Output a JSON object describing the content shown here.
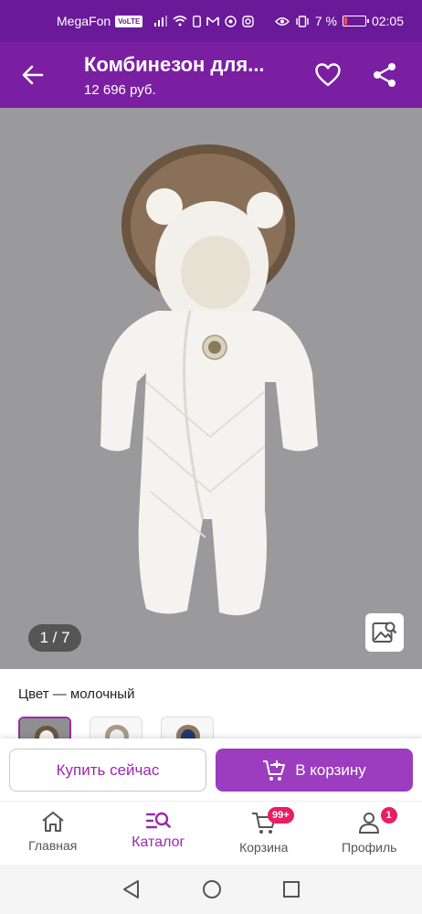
{
  "status_bar": {
    "carrier": "MegaFon",
    "volte": "VoLTE",
    "battery_percent": "7 %",
    "time": "02:05"
  },
  "app_bar": {
    "title": "Комбинезон для...",
    "price": "12 696 руб."
  },
  "gallery": {
    "counter": "1 / 7"
  },
  "color": {
    "label": "Цвет — молочный"
  },
  "actions": {
    "buy_now": "Купить сейчас",
    "add_to_cart": "В корзину"
  },
  "bottom_nav": {
    "items": [
      {
        "label": "Главная",
        "icon": "home-icon"
      },
      {
        "label": "Каталог",
        "icon": "catalog-search-icon"
      },
      {
        "label": "Корзина",
        "icon": "cart-icon",
        "badge": "99+"
      },
      {
        "label": "Профиль",
        "icon": "profile-icon",
        "badge": "1"
      }
    ],
    "active_index": 1
  },
  "colors": {
    "statusbar": "#6a1a99",
    "appbar": "#7b1fa2",
    "accent": "#9c27b0",
    "badge": "#e91e63",
    "gallery_bg": "#9a999b"
  }
}
